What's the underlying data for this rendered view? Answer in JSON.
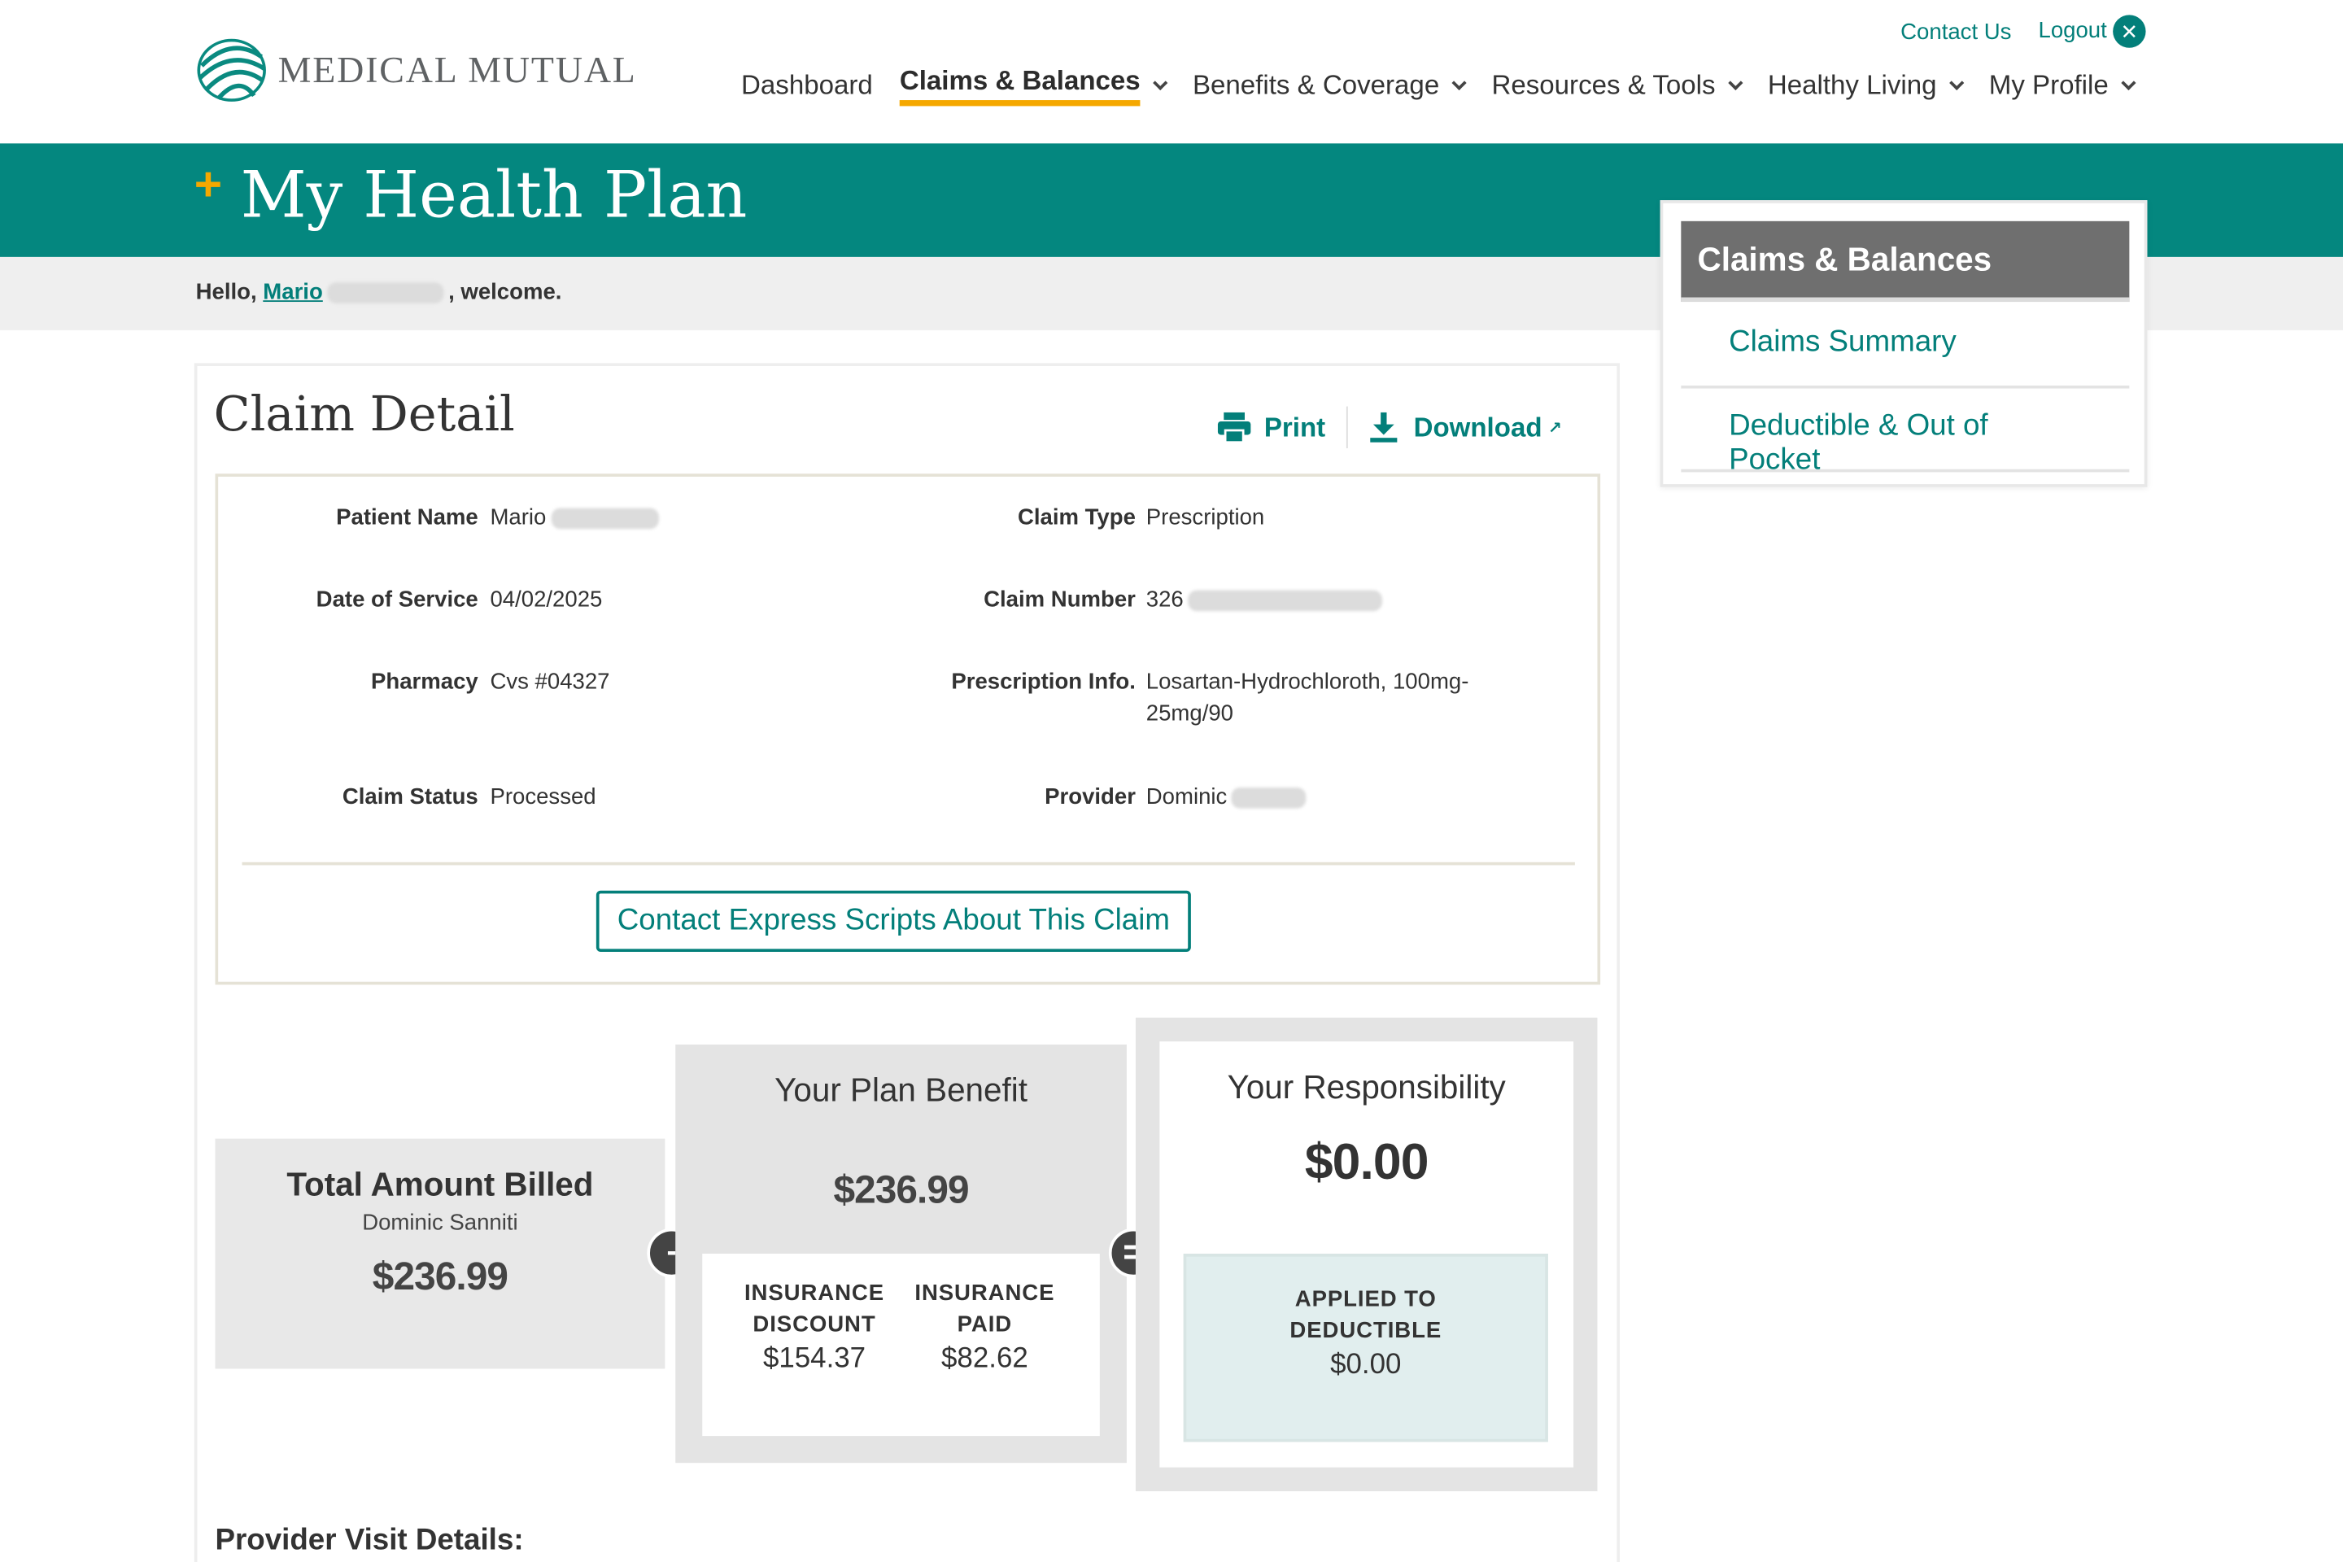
{
  "brand": {
    "name": "MEDICAL MUTUAL",
    "teal": "#04877f",
    "gold": "#f5a800"
  },
  "util": {
    "contact_us": "Contact Us",
    "logout": "Logout"
  },
  "nav": [
    {
      "label": "Dashboard"
    },
    {
      "label": "Claims & Balances"
    },
    {
      "label": "Benefits & Coverage"
    },
    {
      "label": "Resources & Tools"
    },
    {
      "label": "Healthy Living"
    },
    {
      "label": "My Profile"
    }
  ],
  "banner": {
    "title": "My Health Plan"
  },
  "welcome": {
    "hello": "Hello,",
    "first_name": "Mario",
    "suffix": ", welcome."
  },
  "side": {
    "heading": "Claims & Balances",
    "links": [
      "Claims Summary",
      "Deductible & Out of Pocket"
    ]
  },
  "claim": {
    "title": "Claim Detail",
    "print": "Print",
    "download": "Download",
    "fields": {
      "patient_name": {
        "label": "Patient Name",
        "value": "Mario"
      },
      "date_of_service": {
        "label": "Date of Service",
        "value": "04/02/2025"
      },
      "pharmacy": {
        "label": "Pharmacy",
        "value": "Cvs #04327"
      },
      "claim_status": {
        "label": "Claim Status",
        "value": "Processed"
      },
      "claim_type": {
        "label": "Claim Type",
        "value": "Prescription"
      },
      "claim_number": {
        "label": "Claim Number",
        "value": "326"
      },
      "prescription_info": {
        "label": "Prescription Info.",
        "value_line1": "Losartan-Hydrochloroth, 100mg-",
        "value_line2": "25mg/90"
      },
      "provider": {
        "label": "Provider",
        "value": "Dominic"
      }
    },
    "contact_button": "Contact Express Scripts About This Claim"
  },
  "summary": {
    "total": {
      "title": "Total Amount Billed",
      "subtitle": "Dominic Sanniti",
      "amount": "$236.99"
    },
    "minus": "-",
    "plan": {
      "title": "Your Plan Benefit",
      "amount": "$236.99",
      "discount_label_1": "INSURANCE",
      "discount_label_2": "DISCOUNT",
      "discount_value": "$154.37",
      "paid_label_1": "INSURANCE",
      "paid_label_2": "PAID",
      "paid_value": "$82.62"
    },
    "equals": "=",
    "responsibility": {
      "title": "Your Responsibility",
      "amount": "$0.00",
      "deductible_label_1": "APPLIED TO",
      "deductible_label_2": "DEDUCTIBLE",
      "deductible_value": "$0.00"
    }
  },
  "provider_visit": {
    "heading": "Provider Visit Details:"
  }
}
